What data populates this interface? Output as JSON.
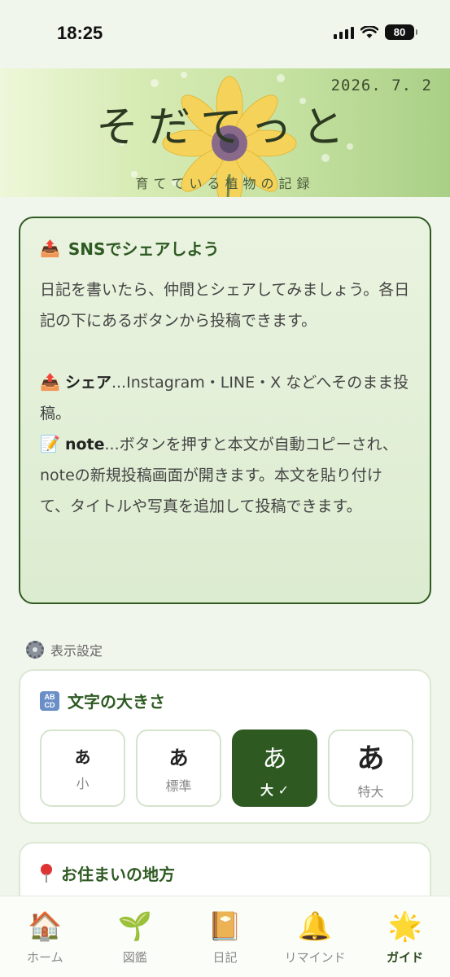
{
  "status_bar": {
    "time": "18:25",
    "battery": "80"
  },
  "header": {
    "date": "2026. 7. 2",
    "title": "そだてっと",
    "subtitle": "育てている植物の記録"
  },
  "share_card": {
    "icon": "outbox-tray-icon",
    "heading": "SNSでシェアしよう",
    "intro": "日記を書いたら、仲間とシェアしてみましょう。各日記の下にあるボタンから投稿できます。",
    "share_title": "シェア",
    "share_text": "...Instagram・LINE・X などへそのまま投稿。",
    "note_icon": "memo-icon",
    "note_title": "note",
    "note_text": "...ボタンを押すと本文が自動コピーされ、noteの新規投稿画面が開きます。本文を貼り付けて、タイトルや写真を追加して投稿できます。"
  },
  "display_settings": {
    "label": "表示設定",
    "font_size": {
      "icon": "abcd-icon",
      "heading": "文字の大きさ",
      "options": [
        {
          "glyph": "あ",
          "label": "小",
          "active": false
        },
        {
          "glyph": "あ",
          "label": "標準",
          "active": false
        },
        {
          "glyph": "あ",
          "label": "大 ✓",
          "active": true
        },
        {
          "glyph": "あ",
          "label": "特大",
          "active": false
        }
      ]
    },
    "region": {
      "icon": "pin-icon",
      "heading": "お住まいの地方"
    }
  },
  "bottom_nav": [
    {
      "label": "ホーム",
      "icon": "🏠",
      "active": false
    },
    {
      "label": "図鑑",
      "icon": "🌱",
      "active": false
    },
    {
      "label": "日記",
      "icon": "📔",
      "active": false
    },
    {
      "label": "リマインド",
      "icon": "🔔",
      "active": false
    },
    {
      "label": "ガイド",
      "icon": "🌟",
      "active": true
    }
  ]
}
